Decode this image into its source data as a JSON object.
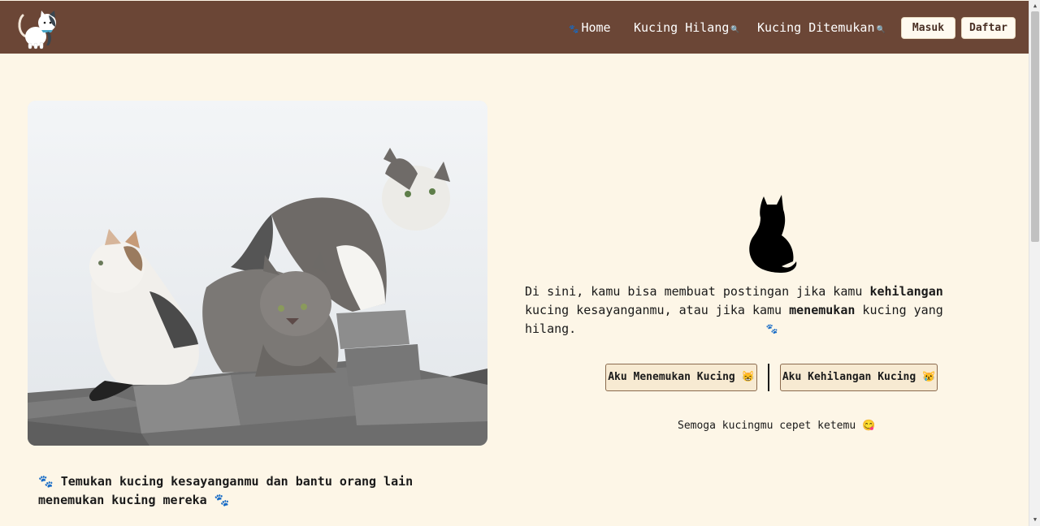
{
  "navbar": {
    "logo_icon": "cat-logo-icon",
    "links": [
      {
        "label": "Home",
        "icon": "paw-icon"
      },
      {
        "label": "Kucing Hilang",
        "icon": "search-icon"
      },
      {
        "label": "Kucing Ditemukan",
        "icon": "search-icon"
      }
    ],
    "login_label": "Masuk",
    "register_label": "Daftar"
  },
  "hero": {
    "image_icon": "cats-on-bricks-photo",
    "tagline": "🐾 Temukan kucing kesayanganmu dan bantu orang lain menemukan kucing mereka 🐾"
  },
  "intro": {
    "cat_icon": "cat-silhouette-icon",
    "text_1": "Di sini, kamu bisa membuat postingan jika kamu ",
    "bold_1": "kehilangan",
    "text_2": " kucing kesayanganmu, atau jika kamu ",
    "bold_2": "menemukan",
    "text_3": " kucing yang hilang.",
    "paw": "🐾"
  },
  "actions": {
    "found_label": "Aku Menemukan Kucing 😸",
    "lost_label": "Aku Kehilangan Kucing 😿"
  },
  "wish": "Semoga kucingmu cepet ketemu 😋",
  "colors": {
    "nav_bg": "#6b4636",
    "page_bg": "#fdf6e7",
    "button_bg": "#f7ead2"
  }
}
